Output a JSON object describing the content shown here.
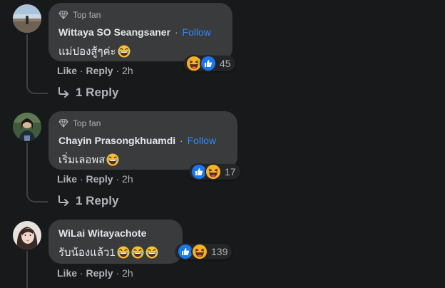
{
  "comments": [
    {
      "badge": "Top fan",
      "author": "Wittaya SO Seangsaner",
      "follow": "Follow",
      "text": "แม่ปองสู้ๆค่ะ",
      "reactions_count": "45",
      "like": "Like",
      "reply": "Reply",
      "time": "2h",
      "replies_label": "1 Reply"
    },
    {
      "badge": "Top fan",
      "author": "Chayin Prasongkhuamdi",
      "follow": "Follow",
      "text": "เริ่มเลอพส",
      "reactions_count": "17",
      "like": "Like",
      "reply": "Reply",
      "time": "2h",
      "replies_label": "1 Reply"
    },
    {
      "author": "WiLai Witayachote",
      "text": "รับน้องแล้ว1",
      "reactions_count": "139",
      "like": "Like",
      "reply": "Reply",
      "time": "2h"
    }
  ],
  "separator": "·",
  "icons": {
    "badge": "diamond-icon",
    "laugh": "laughing-emoji-icon",
    "like": "like-reaction-icon",
    "haha": "haha-reaction-icon",
    "reply_arrow": "reply-arrow-icon"
  },
  "colors": {
    "background": "#18191a",
    "bubble": "#3a3b3c",
    "follow": "#2d88ff",
    "like_reaction": "#1877f2",
    "emoji_yellow": "#f7b125"
  }
}
